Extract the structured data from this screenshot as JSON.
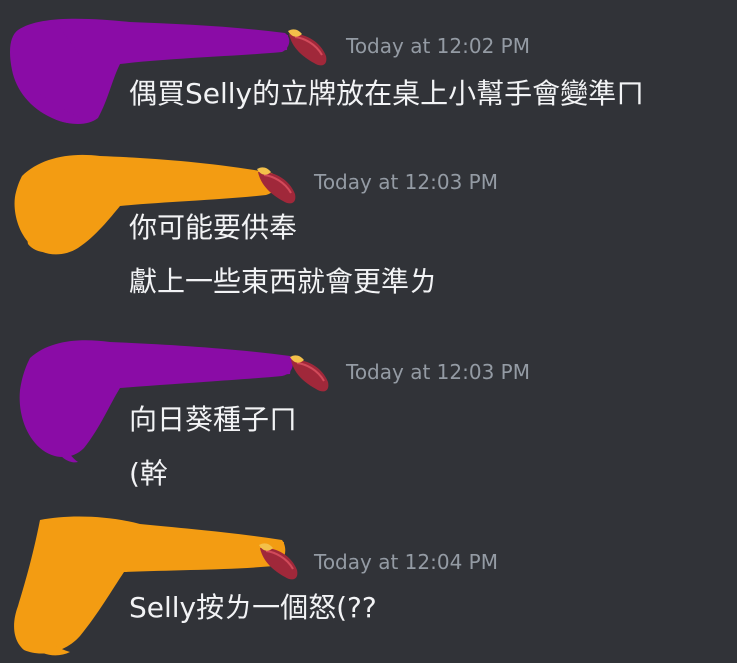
{
  "chat": {
    "messages": [
      {
        "timestamp": "Today at 12:02 PM",
        "lines": [
          "偶買Selly的立牌放在桌上小幫手會變準ㄇ"
        ]
      },
      {
        "timestamp": "Today at 12:03 PM",
        "lines": [
          "你可能要供奉",
          "獻上一些東西就會更準ㄌ"
        ]
      },
      {
        "timestamp": "Today at 12:03 PM",
        "lines": [
          "向日葵種子ㄇ",
          " (幹"
        ]
      },
      {
        "timestamp": "Today at 12:04 PM",
        "lines": [
          "Selly按ㄌ一個怒(??"
        ]
      }
    ]
  },
  "colors": {
    "background": "#313338",
    "text": "#f2f3f5",
    "timestamp": "#949ba4",
    "redaction_purple": "#8a0ca6",
    "redaction_orange": "#f39c12"
  },
  "icons": {
    "role_icon": "sweet-potato-icon"
  }
}
